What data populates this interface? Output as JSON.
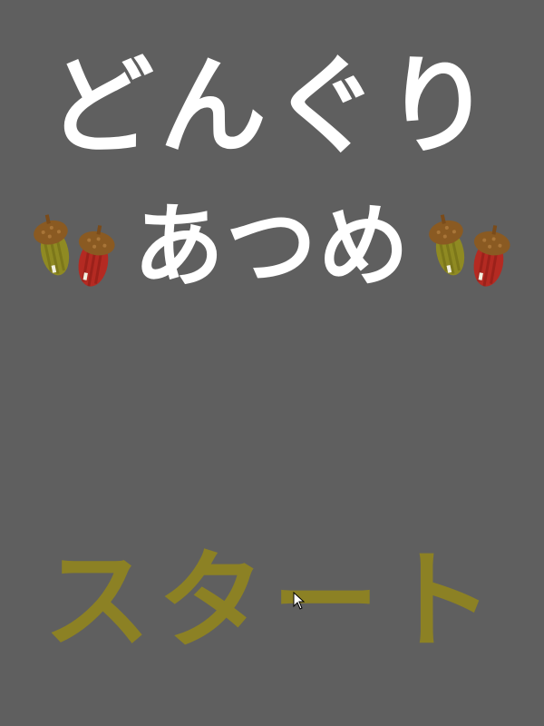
{
  "title": {
    "line1": "どんぐり",
    "line2": "あつめ"
  },
  "start_button": {
    "label": "スタート"
  },
  "icons": {
    "acorn_green": "acorn-green-icon",
    "acorn_red": "acorn-red-icon",
    "cursor": "mouse-pointer-icon"
  },
  "colors": {
    "background": "#5f5f5f",
    "title_text": "#ffffff",
    "start_text": "#8c8124",
    "acorn_cap": "#8a5a22",
    "acorn_green": "#8f8a22",
    "acorn_red": "#b42a22"
  }
}
